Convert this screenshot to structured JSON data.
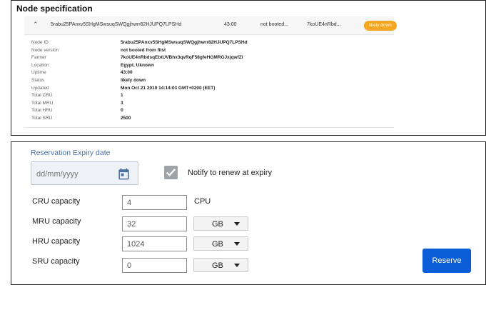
{
  "spec": {
    "title": "Node specification",
    "row": {
      "node_id": "5rabu25PAnxv5SHgMSwsuqSWQgjhwrr82HJUPQ7LPSHd",
      "uptime": "43:00",
      "version": "not booted...",
      "farmer": "7koUE4nRbd...",
      "status": "likely down"
    },
    "details": [
      {
        "label": "Node ID",
        "value": "5rabu25PAnxv5SHgMSwsuqSWQgjhwrr82HJUPQ7LPSHd"
      },
      {
        "label": "Node version",
        "value": "not booted from flist"
      },
      {
        "label": "Farmer",
        "value": "7koUE4nRbdsqEbtUVBhx3qvRqF58gfeHGMRGJxjqwfZi"
      },
      {
        "label": "Location",
        "value": "Egypt, Uknown"
      },
      {
        "label": "Uptime",
        "value": "43:00"
      },
      {
        "label": "Status",
        "value": "likely down"
      },
      {
        "label": "Updated",
        "value": "Mon Oct 21 2019 14:14:03 GMT+0200 (EET)"
      },
      {
        "label": "Total CRU",
        "value": "1"
      },
      {
        "label": "Total MRU",
        "value": "3"
      },
      {
        "label": "Total HRU",
        "value": "0"
      },
      {
        "label": "Total SRU",
        "value": "2500"
      }
    ]
  },
  "reservation": {
    "expiry_label": "Reservation Expiry date",
    "date_placeholder": "dd/mm/yyyy",
    "notify_label": "Notify to renew at expiry",
    "notify_checked": true,
    "cru": {
      "label": "CRU capacity",
      "value": "4",
      "unit": "CPU"
    },
    "mru": {
      "label": "MRU capacity",
      "value": "32",
      "unit": "GB"
    },
    "hru": {
      "label": "HRU capacity",
      "value": "1024",
      "unit": "GB"
    },
    "sru": {
      "label": "SRU capacity",
      "value": "0",
      "unit": "GB"
    },
    "reserve_label": "Reserve"
  },
  "colors": {
    "badge": "#f5a623",
    "reserve_button": "#0b5ed7",
    "expiry_label": "#4a6fa0"
  },
  "icons": {
    "expand": "chevron-up-icon",
    "calendar": "calendar-icon",
    "checkbox": "checkmark-icon",
    "select": "caret-down-icon"
  }
}
